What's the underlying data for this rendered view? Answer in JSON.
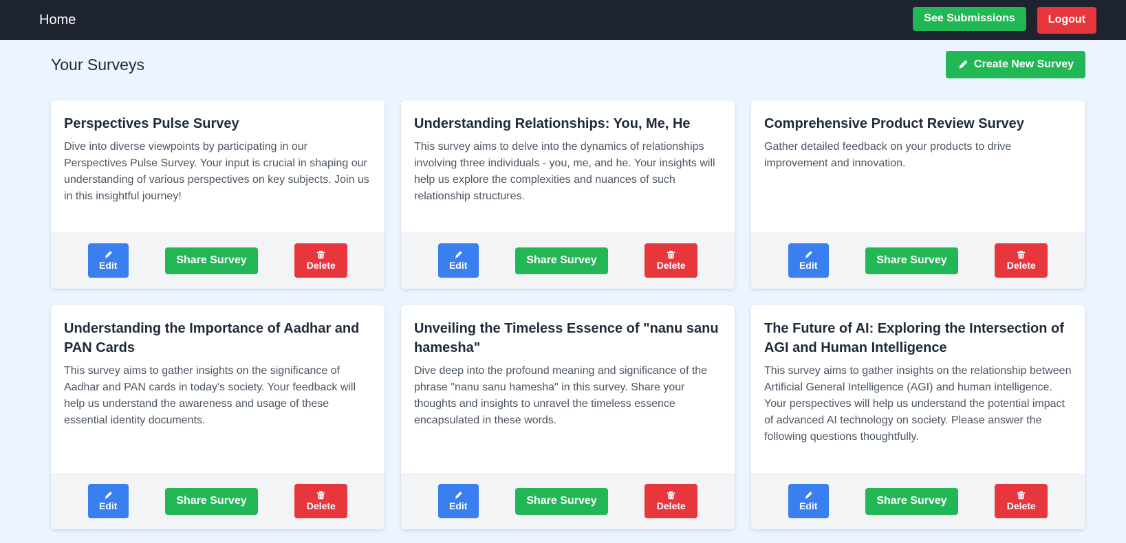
{
  "nav": {
    "home": "Home",
    "see_submissions": "See Submissions",
    "logout": "Logout"
  },
  "header": {
    "title": "Your Surveys",
    "create_button": "Create New Survey"
  },
  "buttons": {
    "edit": "Edit",
    "share": "Share Survey",
    "delete": "Delete"
  },
  "surveys": [
    {
      "title": "Perspectives Pulse Survey",
      "description": "Dive into diverse viewpoints by participating in our Perspectives Pulse Survey. Your input is crucial in shaping our understanding of various perspectives on key subjects. Join us in this insightful journey!"
    },
    {
      "title": "Understanding Relationships: You, Me, He",
      "description": "This survey aims to delve into the dynamics of relationships involving three individuals - you, me, and he. Your insights will help us explore the complexities and nuances of such relationship structures."
    },
    {
      "title": "Comprehensive Product Review Survey",
      "description": "Gather detailed feedback on your products to drive improvement and innovation."
    },
    {
      "title": "Understanding the Importance of Aadhar and PAN Cards",
      "description": "This survey aims to gather insights on the significance of Aadhar and PAN cards in today's society. Your feedback will help us understand the awareness and usage of these essential identity documents."
    },
    {
      "title": "Unveiling the Timeless Essence of \"nanu sanu hamesha\"",
      "description": "Dive deep into the profound meaning and significance of the phrase \"nanu sanu hamesha\" in this survey. Share your thoughts and insights to unravel the timeless essence encapsulated in these words."
    },
    {
      "title": "The Future of AI: Exploring the Intersection of AGI and Human Intelligence",
      "description": "This survey aims to gather insights on the relationship between Artificial General Intelligence (AGI) and human intelligence. Your perspectives will help us understand the potential impact of advanced AI technology on society. Please answer the following questions thoughtfully."
    }
  ],
  "icons": {
    "edit": "pencil-icon",
    "delete": "trash-icon",
    "create": "pencil-icon"
  },
  "colors": {
    "navbar": "#1e2330",
    "background": "#ebf4ff",
    "green": "#22b755",
    "red": "#e8363d",
    "blue": "#3a7ff0"
  }
}
